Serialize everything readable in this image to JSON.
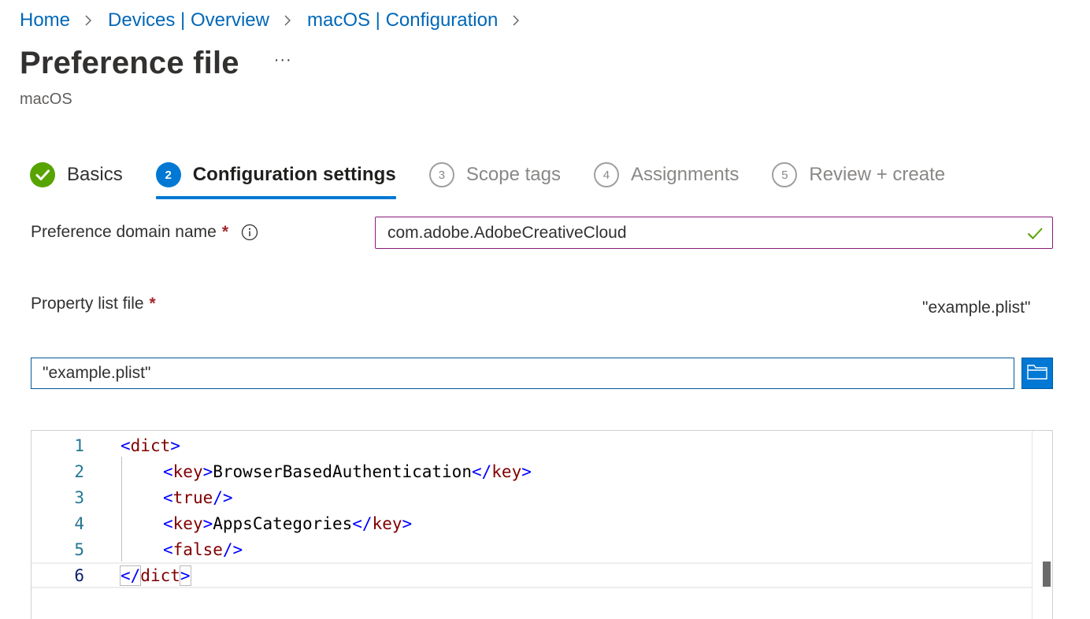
{
  "breadcrumb": {
    "items": [
      "Home",
      "Devices | Overview",
      "macOS | Configuration"
    ]
  },
  "page": {
    "title": "Preference file",
    "more_label": "···",
    "subtitle": "macOS"
  },
  "wizard": {
    "steps": [
      {
        "number": "",
        "label": "Basics",
        "state": "done"
      },
      {
        "number": "2",
        "label": "Configuration settings",
        "state": "current"
      },
      {
        "number": "3",
        "label": "Scope tags",
        "state": "pending"
      },
      {
        "number": "4",
        "label": "Assignments",
        "state": "pending"
      },
      {
        "number": "5",
        "label": "Review + create",
        "state": "pending"
      }
    ]
  },
  "form": {
    "domain": {
      "label": "Preference domain name",
      "required_mark": "*",
      "value": "com.adobe.AdobeCreativeCloud",
      "valid": true
    },
    "plist": {
      "label": "Property list file",
      "required_mark": "*",
      "hint": "\"example.plist\"",
      "value": "\"example.plist\""
    }
  },
  "editor": {
    "lines": [
      {
        "number": "1",
        "indent": 0,
        "tokens": [
          [
            "punct",
            "<"
          ],
          [
            "tag",
            "dict"
          ],
          [
            "punct",
            ">"
          ]
        ]
      },
      {
        "number": "2",
        "indent": 1,
        "tokens": [
          [
            "punct",
            "<"
          ],
          [
            "tag",
            "key"
          ],
          [
            "punct",
            ">"
          ],
          [
            "txt",
            "BrowserBasedAuthentication"
          ],
          [
            "punct",
            "</"
          ],
          [
            "tag",
            "key"
          ],
          [
            "punct",
            ">"
          ]
        ]
      },
      {
        "number": "3",
        "indent": 1,
        "tokens": [
          [
            "punct",
            "<"
          ],
          [
            "tag",
            "true"
          ],
          [
            "punct",
            "/>"
          ]
        ]
      },
      {
        "number": "4",
        "indent": 1,
        "tokens": [
          [
            "punct",
            "<"
          ],
          [
            "tag",
            "key"
          ],
          [
            "punct",
            ">"
          ],
          [
            "txt",
            "AppsCategories"
          ],
          [
            "punct",
            "</"
          ],
          [
            "tag",
            "key"
          ],
          [
            "punct",
            ">"
          ]
        ]
      },
      {
        "number": "5",
        "indent": 1,
        "tokens": [
          [
            "punct",
            "<"
          ],
          [
            "tag",
            "false"
          ],
          [
            "punct",
            "/>"
          ]
        ]
      },
      {
        "number": "6",
        "indent": 0,
        "tokens": [
          [
            "punct",
            "</"
          ],
          [
            "tag",
            "dict"
          ],
          [
            "punct",
            ">"
          ]
        ]
      }
    ],
    "current_line": 6
  },
  "colors": {
    "link": "#0067b8",
    "accent": "#0078d4",
    "success": "#57a300",
    "required": "#a4262c",
    "xml_tag": "#800000",
    "xml_bracket": "#0000ff",
    "line_number": "#237893"
  },
  "icons": {
    "breadcrumb_separator": "chevron-right-icon",
    "step_done": "checkmark-circle-icon",
    "info": "info-icon",
    "valid": "checkmark-icon",
    "browse": "folder-open-icon"
  }
}
